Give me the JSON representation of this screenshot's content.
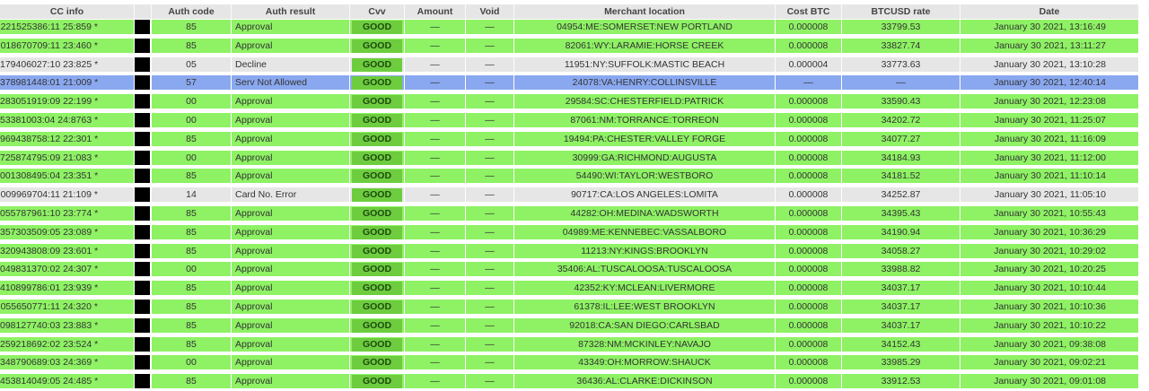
{
  "colors": {
    "approval_row": "#8ef264",
    "decline_row": "#e6e6e6",
    "blocked_row": "#8aa8f0",
    "cvv_good": "#6dcd3f",
    "header": "#e6e6e6"
  },
  "columns": {
    "cc_info": "CC info",
    "auth_code": "Auth code",
    "auth_result": "Auth result",
    "cvv": "Cvv",
    "amount": "Amount",
    "void": "Void",
    "merchant_location": "Merchant location",
    "cost_btc": "Cost BTC",
    "btcusd_rate": "BTCUSD rate",
    "date": "Date"
  },
  "rows": [
    {
      "cc": "221525386:11 25:859 *",
      "auth": "85",
      "result": "Approval",
      "status": "approve",
      "cvv": "GOOD",
      "amount": "—",
      "void": "—",
      "location": "04954:ME:SOMERSET:NEW PORTLAND",
      "cost": "0.000008",
      "rate": "33799.53",
      "date": "January 30 2021, 13:16:49"
    },
    {
      "cc": "018670709:11 23:460 *",
      "auth": "85",
      "result": "Approval",
      "status": "approve",
      "cvv": "GOOD",
      "amount": "—",
      "void": "—",
      "location": "82061:WY:LARAMIE:HORSE CREEK",
      "cost": "0.000008",
      "rate": "33827.74",
      "date": "January 30 2021, 13:11:27"
    },
    {
      "cc": "179406027:10 23:825 *",
      "auth": "05",
      "result": "Decline",
      "status": "decline",
      "cvv": "GOOD",
      "amount": "—",
      "void": "—",
      "location": "11951:NY:SUFFOLK:MASTIC BEACH",
      "cost": "0.000004",
      "rate": "33773.63",
      "date": "January 30 2021, 13:10:28"
    },
    {
      "cc": "378981448:01 21:009 *",
      "auth": "57",
      "result": "Serv Not Allowed",
      "status": "blocked",
      "cvv": "GOOD",
      "amount": "—",
      "void": "—",
      "location": "24078:VA:HENRY:COLLINSVILLE",
      "cost": "—",
      "rate": "—",
      "date": "January 30 2021, 12:40:14"
    },
    {
      "cc": "283051919:09 22:199 *",
      "auth": "00",
      "result": "Approval",
      "status": "approve",
      "cvv": "GOOD",
      "amount": "—",
      "void": "—",
      "location": "29584:SC:CHESTERFIELD:PATRICK",
      "cost": "0.000008",
      "rate": "33590.43",
      "date": "January 30 2021, 12:23:08"
    },
    {
      "cc": "53381003:04 24:8763 *",
      "auth": "00",
      "result": "Approval",
      "status": "approve",
      "cvv": "GOOD",
      "amount": "—",
      "void": "—",
      "location": "87061:NM:TORRANCE:TORREON",
      "cost": "0.000008",
      "rate": "34202.72",
      "date": "January 30 2021, 11:25:07"
    },
    {
      "cc": "969438758:12 22:301 *",
      "auth": "85",
      "result": "Approval",
      "status": "approve",
      "cvv": "GOOD",
      "amount": "—",
      "void": "—",
      "location": "19494:PA:CHESTER:VALLEY FORGE",
      "cost": "0.000008",
      "rate": "34077.27",
      "date": "January 30 2021, 11:16:09"
    },
    {
      "cc": "725874795:09 21:083 *",
      "auth": "00",
      "result": "Approval",
      "status": "approve",
      "cvv": "GOOD",
      "amount": "—",
      "void": "—",
      "location": "30999:GA:RICHMOND:AUGUSTA",
      "cost": "0.000008",
      "rate": "34184.93",
      "date": "January 30 2021, 11:12:00"
    },
    {
      "cc": "001308495:04 23:351 *",
      "auth": "85",
      "result": "Approval",
      "status": "approve",
      "cvv": "GOOD",
      "amount": "—",
      "void": "—",
      "location": "54490:WI:TAYLOR:WESTBORO",
      "cost": "0.000008",
      "rate": "34181.52",
      "date": "January 30 2021, 11:10:14"
    },
    {
      "cc": "009969704:11 21:109 *",
      "auth": "14",
      "result": "Card No. Error",
      "status": "decline",
      "cvv": "GOOD",
      "amount": "—",
      "void": "—",
      "location": "90717:CA:LOS ANGELES:LOMITA",
      "cost": "0.000008",
      "rate": "34252.87",
      "date": "January 30 2021, 11:05:10"
    },
    {
      "cc": "055787961:10 23:774 *",
      "auth": "85",
      "result": "Approval",
      "status": "approve",
      "cvv": "GOOD",
      "amount": "—",
      "void": "—",
      "location": "44282:OH:MEDINA:WADSWORTH",
      "cost": "0.000008",
      "rate": "34395.43",
      "date": "January 30 2021, 10:55:43"
    },
    {
      "cc": "357303509:05 23:089 *",
      "auth": "85",
      "result": "Approval",
      "status": "approve",
      "cvv": "GOOD",
      "amount": "—",
      "void": "—",
      "location": "04989:ME:KENNEBEC:VASSALBORO",
      "cost": "0.000008",
      "rate": "34190.94",
      "date": "January 30 2021, 10:36:29"
    },
    {
      "cc": "320943808:09 23:601 *",
      "auth": "85",
      "result": "Approval",
      "status": "approve",
      "cvv": "GOOD",
      "amount": "—",
      "void": "—",
      "location": "11213:NY:KINGS:BROOKLYN",
      "cost": "0.000008",
      "rate": "34058.27",
      "date": "January 30 2021, 10:29:02"
    },
    {
      "cc": "049831370:02 24:307 *",
      "auth": "00",
      "result": "Approval",
      "status": "approve",
      "cvv": "GOOD",
      "amount": "—",
      "void": "—",
      "location": "35406:AL:TUSCALOOSA:TUSCALOOSA",
      "cost": "0.000008",
      "rate": "33988.82",
      "date": "January 30 2021, 10:20:25"
    },
    {
      "cc": "410899786:01 23:939 *",
      "auth": "85",
      "result": "Approval",
      "status": "approve",
      "cvv": "GOOD",
      "amount": "—",
      "void": "—",
      "location": "42352:KY:MCLEAN:LIVERMORE",
      "cost": "0.000008",
      "rate": "34037.17",
      "date": "January 30 2021, 10:10:44"
    },
    {
      "cc": "055650771:11 24:320 *",
      "auth": "85",
      "result": "Approval",
      "status": "approve",
      "cvv": "GOOD",
      "amount": "—",
      "void": "—",
      "location": "61378:IL:LEE:WEST BROOKLYN",
      "cost": "0.000008",
      "rate": "34037.17",
      "date": "January 30 2021, 10:10:36"
    },
    {
      "cc": "098127740:03 23:883 *",
      "auth": "85",
      "result": "Approval",
      "status": "approve",
      "cvv": "GOOD",
      "amount": "—",
      "void": "—",
      "location": "92018:CA:SAN DIEGO:CARLSBAD",
      "cost": "0.000008",
      "rate": "34037.17",
      "date": "January 30 2021, 10:10:22"
    },
    {
      "cc": "259218692:02 23:524 *",
      "auth": "85",
      "result": "Approval",
      "status": "approve",
      "cvv": "GOOD",
      "amount": "—",
      "void": "—",
      "location": "87328:NM:MCKINLEY:NAVAJO",
      "cost": "0.000008",
      "rate": "34152.43",
      "date": "January 30 2021, 09:38:08"
    },
    {
      "cc": "348790689:03 24:369 *",
      "auth": "00",
      "result": "Approval",
      "status": "approve",
      "cvv": "GOOD",
      "amount": "—",
      "void": "—",
      "location": "43349:OH:MORROW:SHAUCK",
      "cost": "0.000008",
      "rate": "33985.29",
      "date": "January 30 2021, 09:02:21"
    },
    {
      "cc": "453814049:05 24:485 *",
      "auth": "85",
      "result": "Approval",
      "status": "approve",
      "cvv": "GOOD",
      "amount": "—",
      "void": "—",
      "location": "36436:AL:CLARKE:DICKINSON",
      "cost": "0.000008",
      "rate": "33912.53",
      "date": "January 30 2021, 09:01:08"
    }
  ]
}
